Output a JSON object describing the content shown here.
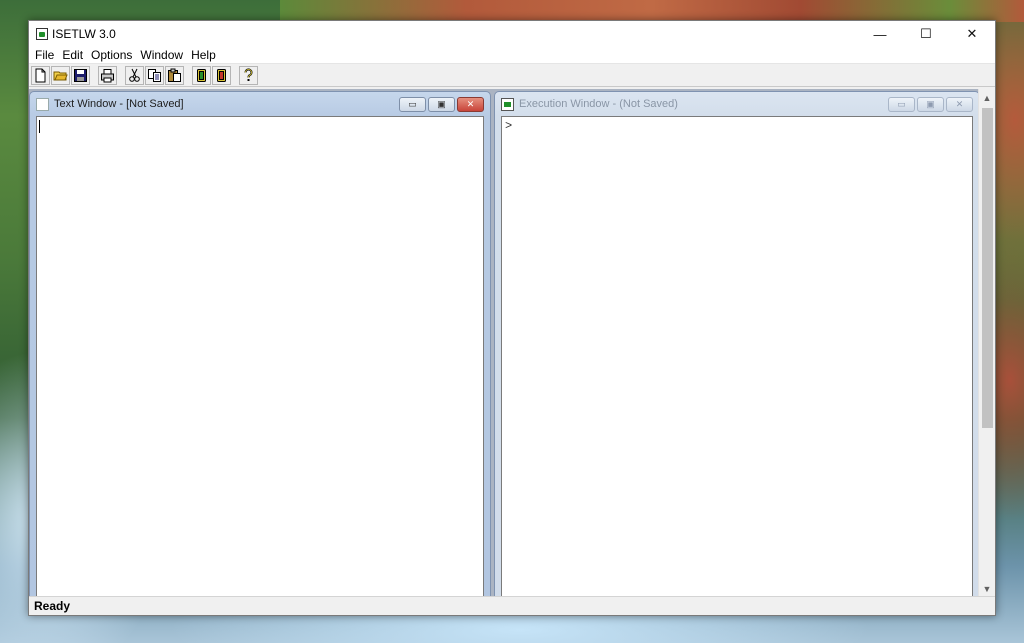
{
  "app": {
    "title": "ISETLW 3.0"
  },
  "window_controls": {
    "minimize": "—",
    "maximize": "☐",
    "close": "✕"
  },
  "menu": [
    "File",
    "Edit",
    "Options",
    "Window",
    "Help"
  ],
  "toolbar": {
    "buttons": [
      {
        "name": "new-file-icon"
      },
      {
        "name": "open-folder-icon"
      },
      {
        "name": "save-icon"
      },
      {
        "name": "print-icon"
      },
      {
        "name": "cut-icon"
      },
      {
        "name": "copy-icon"
      },
      {
        "name": "paste-icon"
      },
      {
        "name": "run-icon"
      },
      {
        "name": "execute-icon"
      },
      {
        "name": "help-icon"
      }
    ]
  },
  "text_window": {
    "title": "Text Window - [Not Saved]",
    "content": ""
  },
  "execution_window": {
    "title": "Execution Window - (Not Saved)",
    "prompt": ">"
  },
  "child_controls": {
    "minimize": "▭",
    "restore": "▣",
    "close": "✕"
  },
  "scrollbar": {
    "up": "▲",
    "down": "▼"
  },
  "status": {
    "text": "Ready"
  },
  "colors": {
    "mdi_background": "#abb4c2",
    "active_child_frame": "#b8cbe4",
    "close_button": "#c8443a",
    "app_icon_green": "#1f8f2a"
  }
}
